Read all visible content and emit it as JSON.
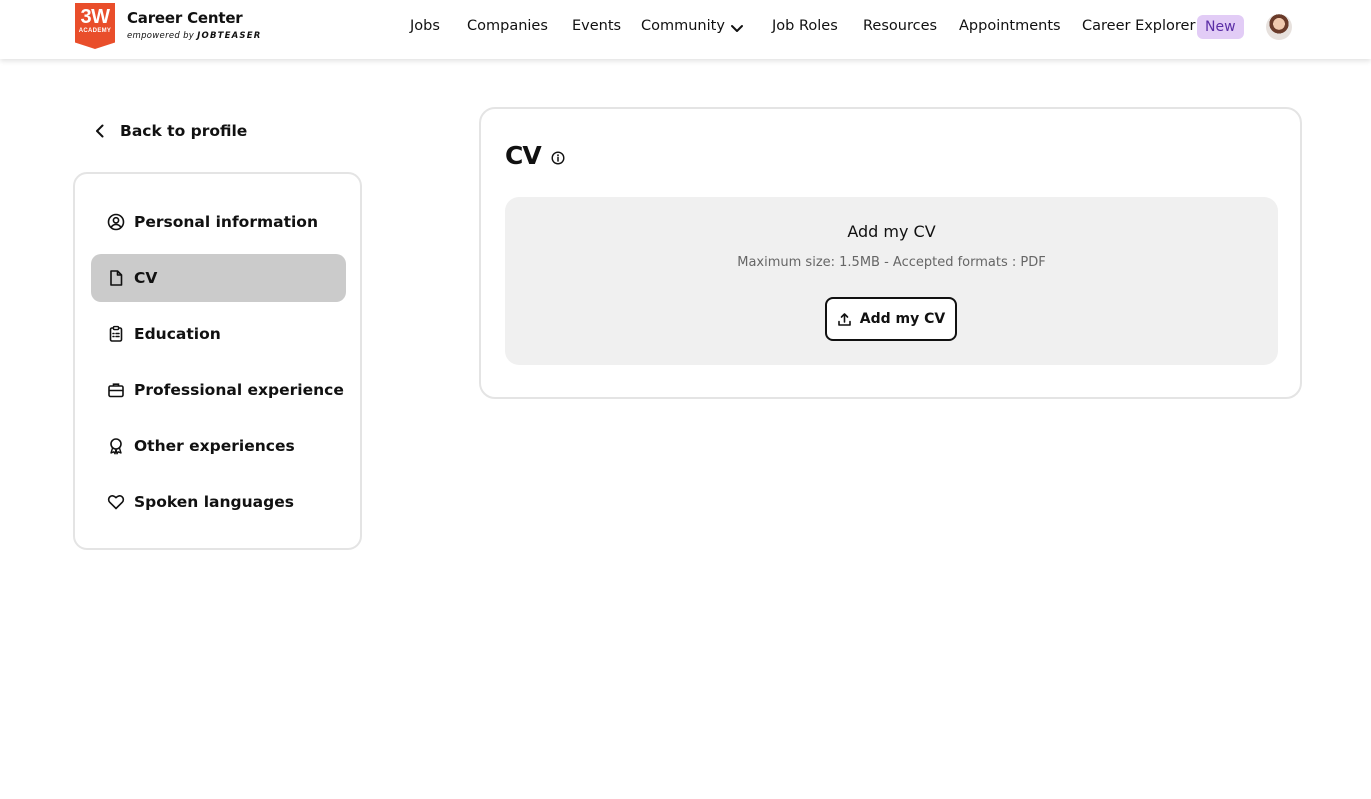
{
  "header": {
    "logo_text": "3W",
    "logo_subtext": "ACADEMY",
    "brand_title": "Career Center",
    "brand_sub_prefix": "empowered by",
    "brand_sub_name": "JOBTEASER",
    "nav": {
      "jobs": "Jobs",
      "companies": "Companies",
      "events": "Events",
      "community": "Community",
      "job_roles": "Job Roles",
      "resources": "Resources",
      "appointments": "Appointments",
      "career_explorer": "Career Explorer"
    },
    "new_badge": "New",
    "icons": [
      "chevron-down-icon",
      "avatar"
    ]
  },
  "sidebar": {
    "back_label": "Back to profile",
    "items": [
      {
        "label": "Personal information",
        "icon": "user-circle-icon"
      },
      {
        "label": "CV",
        "icon": "document-icon",
        "active": true
      },
      {
        "label": "Education",
        "icon": "clipboard-icon"
      },
      {
        "label": "Professional experience",
        "icon": "briefcase-icon"
      },
      {
        "label": "Other experiences",
        "icon": "award-icon"
      },
      {
        "label": "Spoken languages",
        "icon": "heart-icon"
      }
    ]
  },
  "main": {
    "title": "CV",
    "dropzone": {
      "title": "Add my CV",
      "hint": "Maximum size: 1.5MB - Accepted formats : PDF",
      "button_label": "Add my CV"
    }
  },
  "colors": {
    "accent_logo": "#e94e2b",
    "new_badge_bg": "#e2ccf6",
    "new_badge_text": "#5b2ea6",
    "active_item_bg": "#cbcbcb",
    "dropzone_bg": "#f0f0f0"
  }
}
